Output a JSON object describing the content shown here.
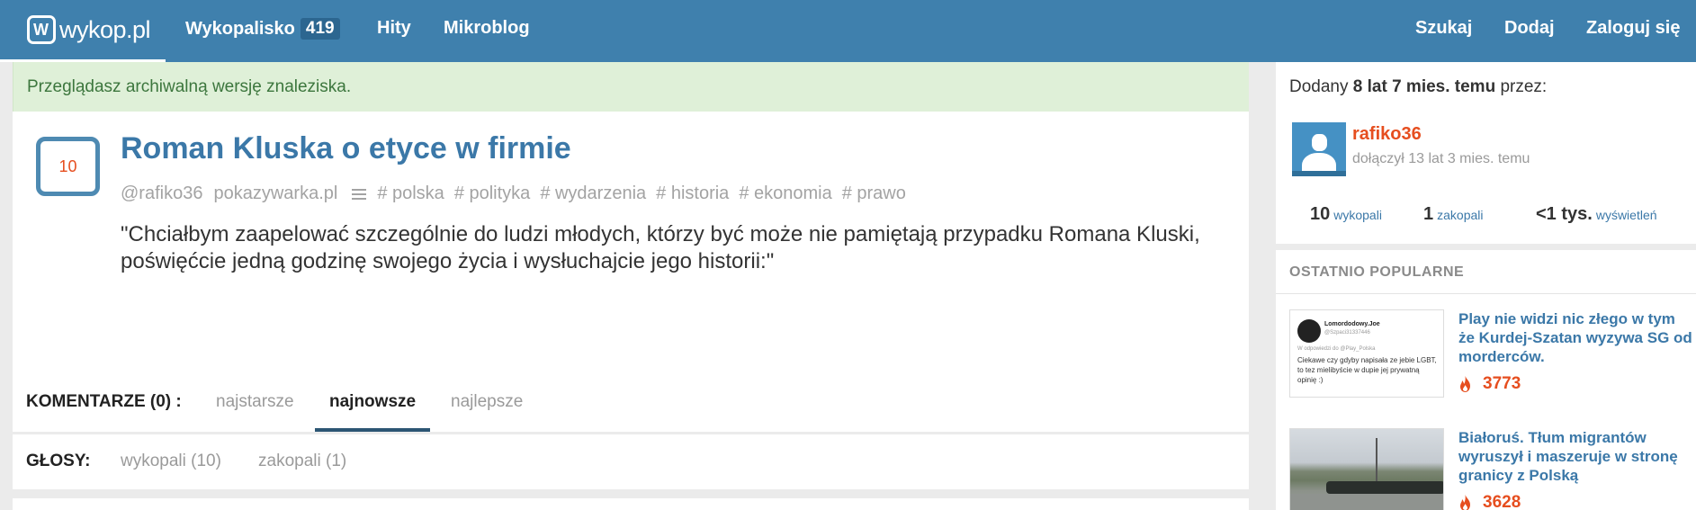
{
  "header": {
    "logo_text": "wykop.pl",
    "logo_mark": "W",
    "nav": [
      {
        "label": "Wykopalisko",
        "count": "419"
      },
      {
        "label": "Hity"
      },
      {
        "label": "Mikroblog"
      }
    ],
    "right_nav": [
      {
        "label": "Szukaj"
      },
      {
        "label": "Dodaj"
      },
      {
        "label": "Zaloguj się"
      }
    ]
  },
  "archive_banner": "Przeglądasz archiwalną wersję znaleziska.",
  "article": {
    "votes": "10",
    "title": "Roman Kluska o etyce w firmie",
    "author": "@rafiko36",
    "source": "pokazywarka.pl",
    "tags": [
      "# polska",
      "# polityka",
      "# wydarzenia",
      "# historia",
      "# ekonomia",
      "# prawo"
    ],
    "description": "\"Chciałbym zaapelować szczególnie do ludzi młodych, którzy być może nie pamiętają przypadku Romana Kluski, poświęćcie jedną godzinę swojego życia i wysłuchajcie jego historii:\""
  },
  "comments": {
    "label": "KOMENTARZE (0) :",
    "sort_tabs": [
      "najstarsze",
      "najnowsze",
      "najlepsze"
    ],
    "active": "najnowsze"
  },
  "votes_panel": {
    "label": "GŁOSY:",
    "tabs": [
      "wykopali (10)",
      "zakopali (1)"
    ]
  },
  "sidebar": {
    "added_prefix": "Dodany",
    "added_time": "8 lat 7 mies. temu",
    "added_suffix": "przez:",
    "author_name": "rafiko36",
    "joined": "dołączył 13 lat 3 mies. temu",
    "stats": [
      {
        "value": "10",
        "label": "wykopali"
      },
      {
        "value": "1",
        "label": "zakopali"
      },
      {
        "value": "<1 tys.",
        "label": "wyświetleń"
      }
    ],
    "popular_header": "OSTATNIO POPULARNE",
    "popular": [
      {
        "title": "Play nie widzi nic złego w tym że Kurdej-Szatan wyzywa SG od morderców.",
        "score": "3773",
        "thumb": {
          "name": "Lomordodowy.Joe",
          "handle": "@Szpaci31337446",
          "reply": "W odpowiedzi do @Play_Polska",
          "text": "Ciekawe czy gdyby napisała ze jebie LGBT, to tez mielibyście w dupie jej prywatną opinię :)"
        }
      },
      {
        "title": "Białoruś. Tłum migrantów wyruszył i maszeruje w stronę granicy z Polską",
        "score": "3628"
      }
    ]
  },
  "colors": {
    "topbar": "#3f80ad",
    "accent_orange": "#e64e1f",
    "link_blue": "#3b78a8",
    "banner_green": "#dff0d8"
  }
}
